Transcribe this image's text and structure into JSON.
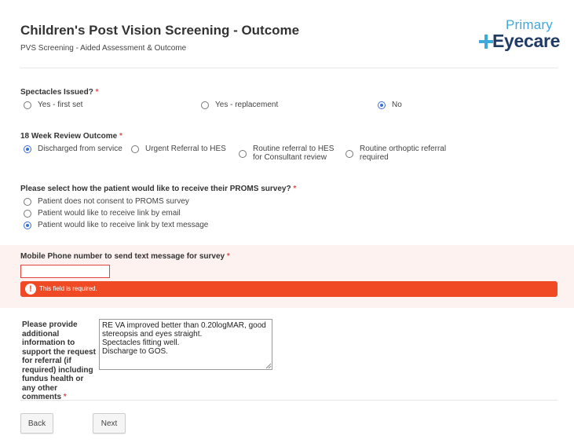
{
  "header": {
    "title": "Children's Post Vision Screening - Outcome",
    "subtitle": "PVS Screening - Aided Assessment & Outcome",
    "logo": {
      "top_text": "Primary",
      "main_text": "Eyecare"
    }
  },
  "spectacles": {
    "label": "Spectacles Issued?",
    "required": "*",
    "options": [
      {
        "label": "Yes - first set",
        "selected": false
      },
      {
        "label": "Yes - replacement",
        "selected": false
      },
      {
        "label": "No",
        "selected": true
      }
    ]
  },
  "review": {
    "label": "18 Week Review Outcome",
    "required": "*",
    "options": [
      {
        "label": "Discharged from service",
        "selected": true
      },
      {
        "label": "Urgent Referral to HES",
        "selected": false
      },
      {
        "label": "Routine referral to HES for Consultant review",
        "selected": false
      },
      {
        "label": "Routine orthoptic referral required",
        "selected": false
      }
    ]
  },
  "proms": {
    "label": "Please select how the patient would like to receive their PROMS survey?",
    "required": "*",
    "options": [
      {
        "label": "Patient does not consent to PROMS survey",
        "selected": false
      },
      {
        "label": "Patient would like to receive link by email",
        "selected": false
      },
      {
        "label": "Patient would like to receive link by text message",
        "selected": true
      }
    ]
  },
  "phone": {
    "label": "Mobile Phone number to send text message for survey",
    "required": "*",
    "value": "",
    "error": "This field is required."
  },
  "info": {
    "label": "Please provide additional information to support the request for referral (if required) including fundus health or any other comments",
    "required": "*",
    "value": "RE VA improved better than 0.20logMAR, good stereopsis and eyes straight.\nSpectacles fitting well.\nDischarge to GOS."
  },
  "buttons": {
    "back": "Back",
    "next": "Next"
  },
  "colors": {
    "accent": "#3b6fd6",
    "error": "#f04a24",
    "logo_light": "#3fa9dc",
    "logo_dark": "#1f3b66"
  }
}
